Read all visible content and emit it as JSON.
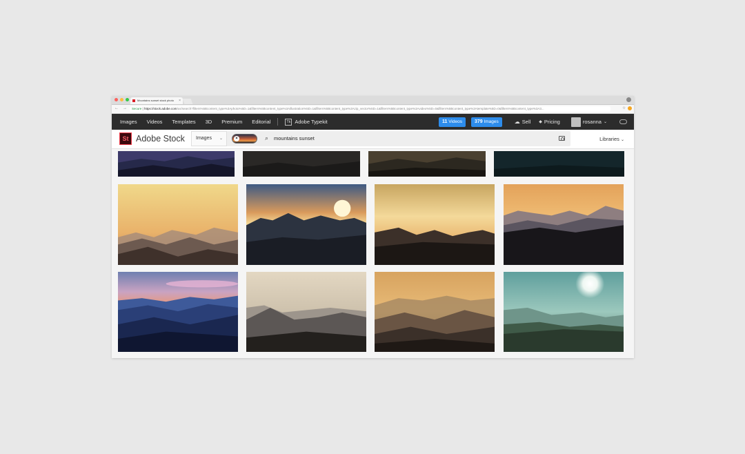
{
  "browser": {
    "tab_title": "Mountains sunset stock photo",
    "url_secure": "Secure",
    "url_host": "https://stock.adobe.com",
    "url_path": "/us/search?filters%5Bcontent_type%3Aphoto%5D=1&filters%5Bcontent_type%3Aillustration%5D=1&filters%5Bcontent_type%3Azip_vector%5D=1&filters%5Bcontent_type%3Avideo%5D=0&filters%5Bcontent_type%3Atemplate%5D=0&filters%5Bcontent_type%3A3..."
  },
  "topnav": {
    "links": [
      "Images",
      "Videos",
      "Templates",
      "3D",
      "Premium",
      "Editorial"
    ],
    "typekit_label": "Adobe Typekit",
    "videos_count": "11",
    "videos_label": "Videos",
    "images_count": "379",
    "images_label": "Images",
    "sell_label": "Sell",
    "pricing_label": "Pricing",
    "user_name": "rosanna"
  },
  "searchbar": {
    "brand_mark": "St",
    "brand_name": "Adobe Stock",
    "content_type": "Images",
    "query": "mountains sunset",
    "libraries_label": "Libraries"
  },
  "colors": {
    "nav_bg": "#2c2c2c",
    "pill_blue": "#2d8ceb",
    "brand_red": "#f03a47"
  },
  "results": {
    "thumbnails": [
      "mountain-dusk-blue",
      "mountain-night-dark",
      "mountain-dusk-brown",
      "mountain-night-teal",
      "hazy-golden-ridges",
      "sun-over-peaks",
      "golden-sky-silhouette",
      "orange-haze-peaks",
      "pink-cloud-blue-ridges",
      "pale-misty-valley",
      "golden-layered-haze",
      "teal-sun-hills"
    ]
  }
}
